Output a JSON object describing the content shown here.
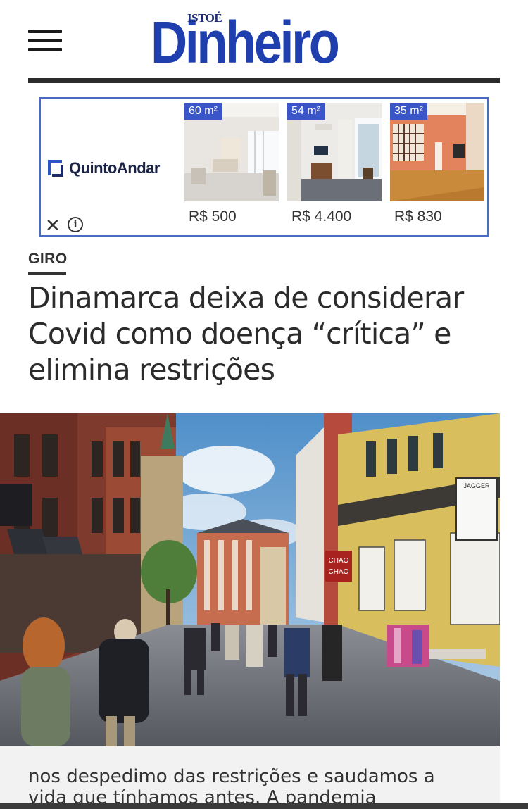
{
  "header": {
    "logo_small": "ISTOÉ",
    "logo_main": "Dinheiro"
  },
  "ad": {
    "brand": "QuintoAndar",
    "listings": [
      {
        "area": "60 m²",
        "price": "R$ 500"
      },
      {
        "area": "54 m²",
        "price": "R$ 4.400"
      },
      {
        "area": "35 m²",
        "price": "R$ 830"
      }
    ]
  },
  "article": {
    "kicker": "GIRO",
    "headline": "Dinamarca deixa de considerar Covid como doença “crítica” e elimina restrições",
    "body": "nos despedimo das restrições e saudamos a vida que tínhamos antes. A pandemia",
    "photo_signs": {
      "shop": "JAGGER",
      "cafe_top": "CHAO",
      "cafe_bottom": "CHAO"
    }
  }
}
